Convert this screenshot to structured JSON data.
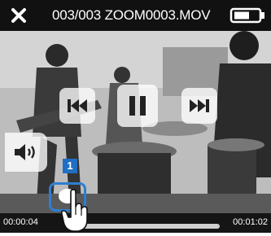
{
  "header": {
    "title": "003/003 ZOOM0003.MOV",
    "close_icon": "close-x-icon",
    "battery_icon": "battery-icon"
  },
  "player": {
    "controls": {
      "previous_icon": "skip-previous-icon",
      "pause_icon": "pause-icon",
      "next_icon": "skip-next-icon",
      "volume_icon": "volume-icon"
    },
    "elapsed_time": "00:00:04",
    "total_time": "00:01:02",
    "progress_fraction": 0.06
  },
  "annotation": {
    "step_number": "1",
    "hand_icon": "pointing-hand-icon"
  },
  "colors": {
    "accent": "#2d7fd0",
    "badge": "#1f6fc4",
    "bar": "#111111"
  }
}
